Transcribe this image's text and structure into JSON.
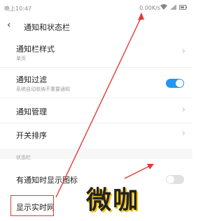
{
  "status_bar": {
    "time": "晚上10:47",
    "network_speed": "0.00K/s"
  },
  "header": {
    "title": "通知和状态栏"
  },
  "settings": {
    "notif_style": {
      "label": "通知栏样式",
      "value": "单页"
    },
    "notif_filter": {
      "label": "通知过滤",
      "desc": "系统自动收纳不重要通知",
      "enabled": true
    },
    "notif_manage": {
      "label": "通知管理"
    },
    "switch_order": {
      "label": "开关排序"
    }
  },
  "status_section": {
    "header": "状态栏",
    "show_icon": {
      "label": "有通知时显示图标",
      "enabled": false
    },
    "show_speed": {
      "label": "显示实时网"
    }
  },
  "overlay": {
    "watermark": "微咖"
  },
  "colors": {
    "accent": "#2196f3",
    "arrow": "#e53935",
    "logo_shadow": "#f5c400"
  }
}
